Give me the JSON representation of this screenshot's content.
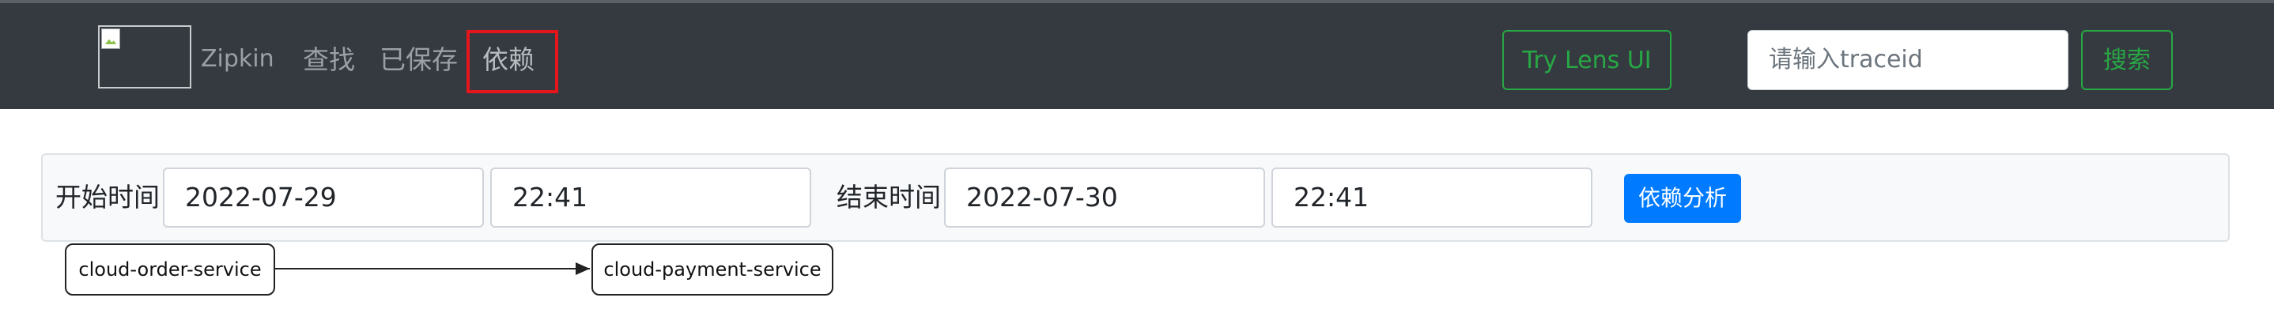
{
  "navbar": {
    "brand": "Zipkin",
    "links": [
      "查找",
      "已保存",
      "依赖"
    ],
    "active_link": "依赖",
    "highlight_color": "#e4161b",
    "lens_button": "Try Lens UI",
    "trace_input_placeholder": "请输入traceid",
    "search_button": "搜索"
  },
  "form": {
    "start_label": "开始时间",
    "start_date": "2022-07-29",
    "start_time": "22:41",
    "end_label": "结束时间",
    "end_date": "2022-07-30",
    "end_time": "22:41",
    "analyze_button": "依赖分析"
  },
  "graph": {
    "nodes": [
      "cloud-order-service",
      "cloud-payment-service"
    ],
    "edges": [
      {
        "from": "cloud-order-service",
        "to": "cloud-payment-service"
      }
    ]
  },
  "colors": {
    "navbar_bg": "#343a40",
    "success": "#28a745",
    "primary": "#007bff"
  }
}
